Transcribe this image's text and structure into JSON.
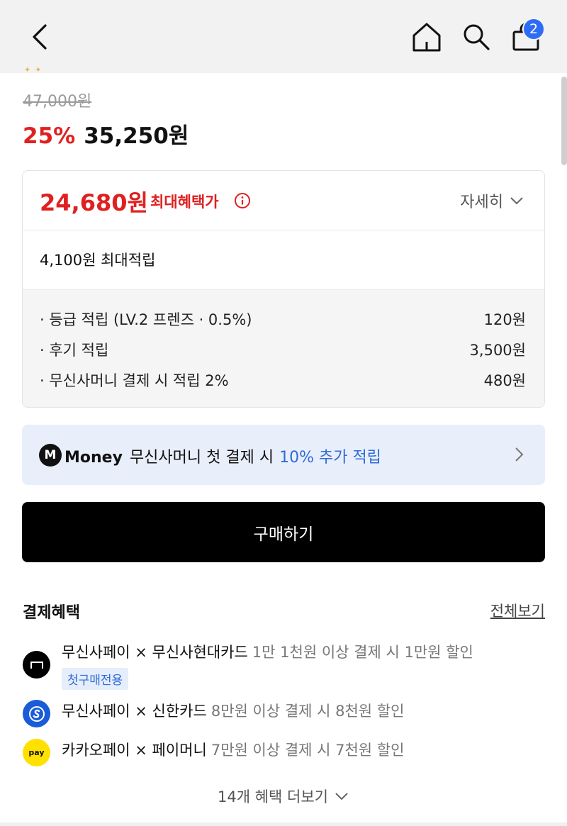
{
  "header": {
    "back_icon": "chevron-left-icon",
    "home_icon": "home-icon",
    "search_icon": "search-icon",
    "cart_icon": "shopping-bag-icon",
    "cart_count": "2"
  },
  "price": {
    "original": "47,000원",
    "discount": "25%",
    "sale": "35,250원"
  },
  "max_benefit": {
    "price": "24,680원",
    "label": "최대혜택가",
    "detail_label": "자세히",
    "points_total": "4,100원 최대적립",
    "rows": [
      {
        "label": "· 등급 적립 (LV.2 프렌즈 · 0.5%)",
        "value": "120원"
      },
      {
        "label": "· 후기 적립",
        "value": "3,500원"
      },
      {
        "label": "· 무신사머니 결제 시 적립 2%",
        "value": "480원"
      }
    ]
  },
  "money_banner": {
    "logo": "M",
    "brand": "Money",
    "text": "무신사머니 첫 결제 시",
    "highlight": "10% 추가 적립",
    "accent": "#2f6cd6"
  },
  "buy_button": "구매하기",
  "payment_benefits": {
    "title": "결제혜택",
    "view_all": "전체보기",
    "items": [
      {
        "name": "무신사페이 × 무신사현대카드",
        "desc": "1만 1천원 이상 결제 시 1만원 할인",
        "tag": "첫구매전용",
        "logo_color": "#000000"
      },
      {
        "name": "무신사페이 × 신한카드",
        "desc": "8만원 이상 결제 시 8천원 할인",
        "logo_color": "#1a5bd8"
      },
      {
        "name": "카카오페이 × 페이머니",
        "desc": "7만원 이상 결제 시 7천원 할인",
        "logo_text": "pay",
        "logo_color": "#ffe100"
      }
    ],
    "more": "14개 혜택 더보기"
  },
  "colors": {
    "red": "#e02020",
    "badge_blue": "#2f6cf6"
  }
}
